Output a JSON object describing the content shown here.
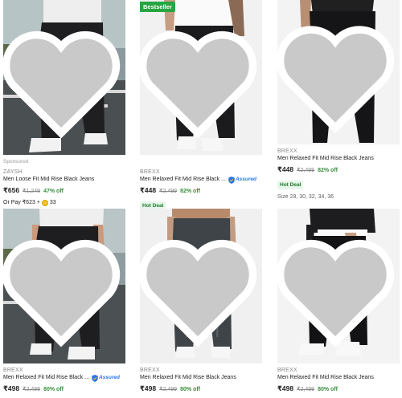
{
  "icon_names": [
    "heart-outline-icon",
    "assured-shield-icon",
    "coin-icon"
  ],
  "colors": {
    "discount": "#388e3c",
    "assured": "#2874f0",
    "badge": "#26a541",
    "hot_deal_bg": "#e7f6ea"
  },
  "products": [
    {
      "sponsored": "Sponsored",
      "brand": "ZAYSH",
      "title": "Men Loose Fit Mid Rise Black Jeans",
      "price": "₹656",
      "mrp": "₹1,249",
      "discount": "47% off",
      "pay_prefix": "Or Pay ₹623 +",
      "coins": "33"
    },
    {
      "badge": "Bestseller",
      "brand": "BREXX",
      "title": "Men Relaxed Fit Mid Rise Black ...",
      "assured": "Assured",
      "price": "₹448",
      "mrp": "₹2,499",
      "discount": "82% off",
      "hot_deal": "Hot Deal"
    },
    {
      "brand": "BREXX",
      "title": "Men Relaxed Fit Mid Rise Black Jeans",
      "price": "₹448",
      "mrp": "₹2,499",
      "discount": "82% off",
      "hot_deal": "Hot Deal",
      "sizes": "Size 28, 30, 32, 34, 36"
    },
    {
      "brand": "BREXX",
      "title": "Men Relaxed Fit Mid Rise Black ...",
      "assured": "Assured",
      "price": "₹498",
      "mrp": "₹2,499",
      "discount": "80% off"
    },
    {
      "brand": "BREXX",
      "title": "Men Relaxed Fit Mid Rise Black Jeans",
      "price": "₹498",
      "mrp": "₹2,499",
      "discount": "80% off"
    },
    {
      "brand": "BREXX",
      "title": "Men Relaxed Fit Mid Rise Black Jeans",
      "price": "₹498",
      "mrp": "₹2,499",
      "discount": "80% off"
    }
  ]
}
